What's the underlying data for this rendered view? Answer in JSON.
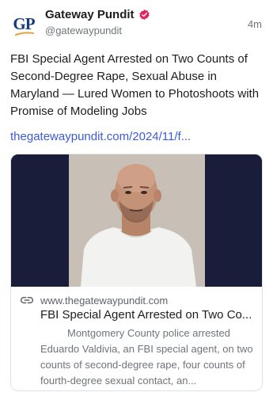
{
  "author": {
    "name": "Gateway Pundit",
    "handle": "@gatewaypundit",
    "avatar_text": "GP",
    "verified_color": "#e0245e"
  },
  "timestamp": "4m",
  "post": {
    "text": "FBI Special Agent Arrested on Two Counts of Second-Degree Rape, Sexual Abuse in Maryland — Lured Women to Photoshoots with Promise of Modeling Jobs",
    "link_text": "thegatewaypundit.com/2024/11/f..."
  },
  "link_card": {
    "domain": "www.thegatewaypundit.com",
    "title": "FBI Special Agent Arrested on Two Co...",
    "description": "Montgomery County police arrested Eduardo Valdivia, an FBI special agent, on two counts of second-degree rape, four counts of fourth-degree sexual contact, an..."
  },
  "colors": {
    "link": "#3b5bdb",
    "image_background": "#1a1d3a",
    "avatar_text": "#173a7a"
  }
}
